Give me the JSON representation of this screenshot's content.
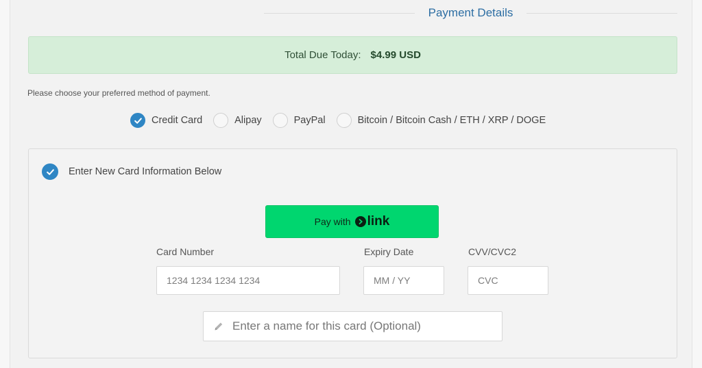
{
  "header": {
    "title": "Payment Details"
  },
  "total": {
    "label": "Total Due Today:",
    "amount": "$4.99 USD"
  },
  "payment_prompt": "Please choose your preferred method of payment.",
  "methods": [
    {
      "label": "Credit Card",
      "selected": true
    },
    {
      "label": "Alipay",
      "selected": false
    },
    {
      "label": "PayPal",
      "selected": false
    },
    {
      "label": "Bitcoin / Bitcoin Cash / ETH / XRP / DOGE",
      "selected": false
    }
  ],
  "card": {
    "new_card_label": "Enter New Card Information Below",
    "link_button": {
      "prefix": "Pay with",
      "brand": "link"
    },
    "card_number": {
      "label": "Card Number",
      "placeholder": "1234 1234 1234 1234"
    },
    "expiry": {
      "label": "Expiry Date",
      "placeholder": "MM / YY"
    },
    "cvv": {
      "label": "CVV/CVC2",
      "placeholder": "CVC"
    },
    "name": {
      "placeholder": "Enter a name for this card (Optional)"
    }
  },
  "colors": {
    "accent": "#2f86c4",
    "title": "#2d6ea3",
    "total_bg": "#d6eed9",
    "link_green": "#00d66f"
  },
  "icons": {
    "check": "check-icon",
    "pencil": "pencil-icon",
    "link_arrow": "link-arrow-icon"
  }
}
